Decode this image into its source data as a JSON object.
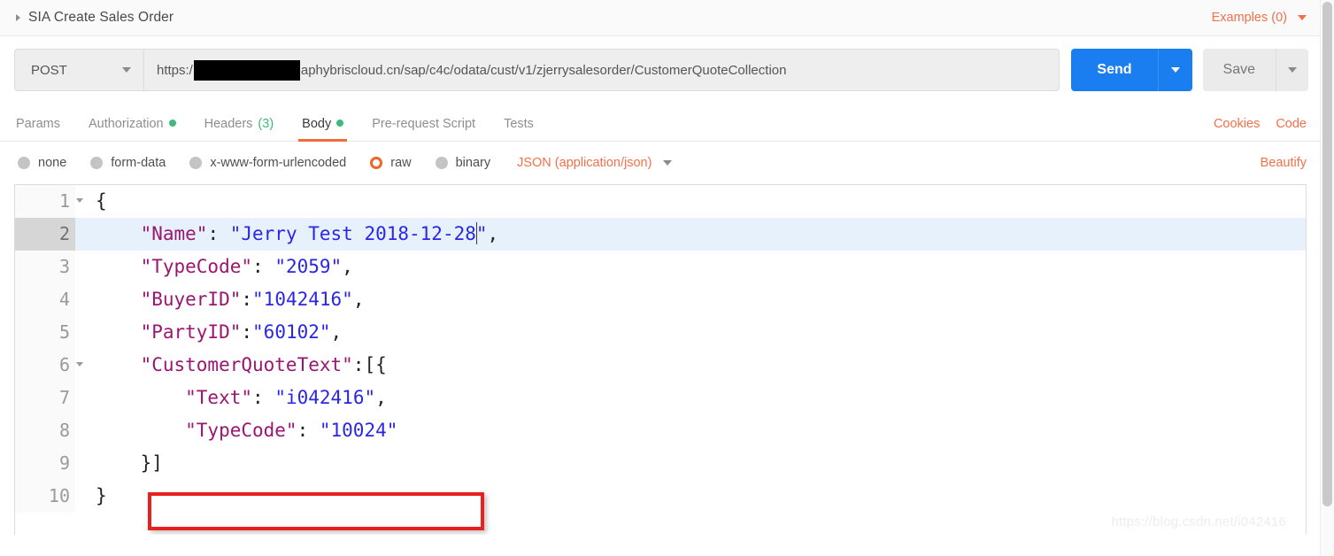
{
  "breadcrumb": {
    "caret_icon": "triangle-right-icon",
    "title": "SIA Create Sales Order",
    "examples_label": "Examples (0)",
    "examples_caret_icon": "chevron-down-icon"
  },
  "request": {
    "method": "POST",
    "method_caret_icon": "chevron-down-icon",
    "url_prefix": "https:/",
    "url_redacted": "",
    "url_suffix": "aphybriscloud.cn/sap/c4c/odata/cust/v1/zjerrysalesorder/CustomerQuoteCollection",
    "send_label": "Send",
    "send_caret_icon": "chevron-down-icon",
    "save_label": "Save",
    "save_caret_icon": "chevron-down-icon"
  },
  "tabs": [
    {
      "label": "Params",
      "dot": false,
      "count": "",
      "active": false
    },
    {
      "label": "Authorization",
      "dot": true,
      "count": "",
      "active": false
    },
    {
      "label": "Headers",
      "dot": false,
      "count": "(3)",
      "active": false
    },
    {
      "label": "Body",
      "dot": true,
      "count": "",
      "active": true
    },
    {
      "label": "Pre-request Script",
      "dot": false,
      "count": "",
      "active": false
    },
    {
      "label": "Tests",
      "dot": false,
      "count": "",
      "active": false
    }
  ],
  "tab_actions": {
    "cookies": "Cookies",
    "code": "Code"
  },
  "body_types": [
    {
      "label": "none",
      "selected": false
    },
    {
      "label": "form-data",
      "selected": false
    },
    {
      "label": "x-www-form-urlencoded",
      "selected": false
    },
    {
      "label": "raw",
      "selected": true
    },
    {
      "label": "binary",
      "selected": false
    }
  ],
  "content_type": {
    "label": "JSON (application/json)",
    "caret_icon": "chevron-down-icon"
  },
  "beautify_label": "Beautify",
  "editor": {
    "lines": [
      {
        "num": "1",
        "fold": true,
        "active": false,
        "tokens": [
          {
            "t": "p",
            "s": "{"
          }
        ]
      },
      {
        "num": "2",
        "fold": false,
        "active": true,
        "tokens": [
          {
            "t": "k",
            "s": "    \"Name\""
          },
          {
            "t": "p",
            "s": ": "
          },
          {
            "t": "v",
            "s": "\"Jerry Test 2018-12-28"
          },
          {
            "t": "caret",
            "s": ""
          },
          {
            "t": "v",
            "s": "\""
          },
          {
            "t": "p",
            "s": ","
          }
        ]
      },
      {
        "num": "3",
        "fold": false,
        "active": false,
        "tokens": [
          {
            "t": "k",
            "s": "    \"TypeCode\""
          },
          {
            "t": "p",
            "s": ": "
          },
          {
            "t": "v",
            "s": "\"2059\""
          },
          {
            "t": "p",
            "s": ","
          }
        ]
      },
      {
        "num": "4",
        "fold": false,
        "active": false,
        "tokens": [
          {
            "t": "k",
            "s": "    \"BuyerID\""
          },
          {
            "t": "p",
            "s": ":"
          },
          {
            "t": "v",
            "s": "\"1042416\""
          },
          {
            "t": "p",
            "s": ","
          }
        ]
      },
      {
        "num": "5",
        "fold": false,
        "active": false,
        "tokens": [
          {
            "t": "k",
            "s": "    \"PartyID\""
          },
          {
            "t": "p",
            "s": ":"
          },
          {
            "t": "v",
            "s": "\"60102\""
          },
          {
            "t": "p",
            "s": ","
          }
        ]
      },
      {
        "num": "6",
        "fold": true,
        "active": false,
        "tokens": [
          {
            "t": "k",
            "s": "    \"CustomerQuoteText\""
          },
          {
            "t": "p",
            "s": ":[{"
          }
        ]
      },
      {
        "num": "7",
        "fold": false,
        "active": false,
        "tokens": [
          {
            "t": "k",
            "s": "        \"Text\""
          },
          {
            "t": "p",
            "s": ": "
          },
          {
            "t": "v",
            "s": "\"i042416\""
          },
          {
            "t": "p",
            "s": ","
          }
        ]
      },
      {
        "num": "8",
        "fold": false,
        "active": false,
        "tokens": [
          {
            "t": "k",
            "s": "        \"TypeCode\""
          },
          {
            "t": "p",
            "s": ": "
          },
          {
            "t": "v",
            "s": "\"10024\""
          }
        ]
      },
      {
        "num": "9",
        "fold": false,
        "active": false,
        "tokens": [
          {
            "t": "p",
            "s": "    }]"
          }
        ]
      },
      {
        "num": "10",
        "fold": false,
        "active": false,
        "tokens": [
          {
            "t": "p",
            "s": "}"
          }
        ]
      }
    ]
  },
  "annotation": {
    "type": "red-rectangle-highlight",
    "target_line": "4"
  },
  "watermark": "https://blog.csdn.net/i042416",
  "colors": {
    "accent_orange": "#f3704a",
    "send_blue": "#1a7ef0",
    "status_green": "#3dbb7e",
    "annotation_red": "#e8211c",
    "json_key": "#9b1670",
    "json_string": "#2a26e8",
    "active_line_bg": "#e7f1fc"
  }
}
